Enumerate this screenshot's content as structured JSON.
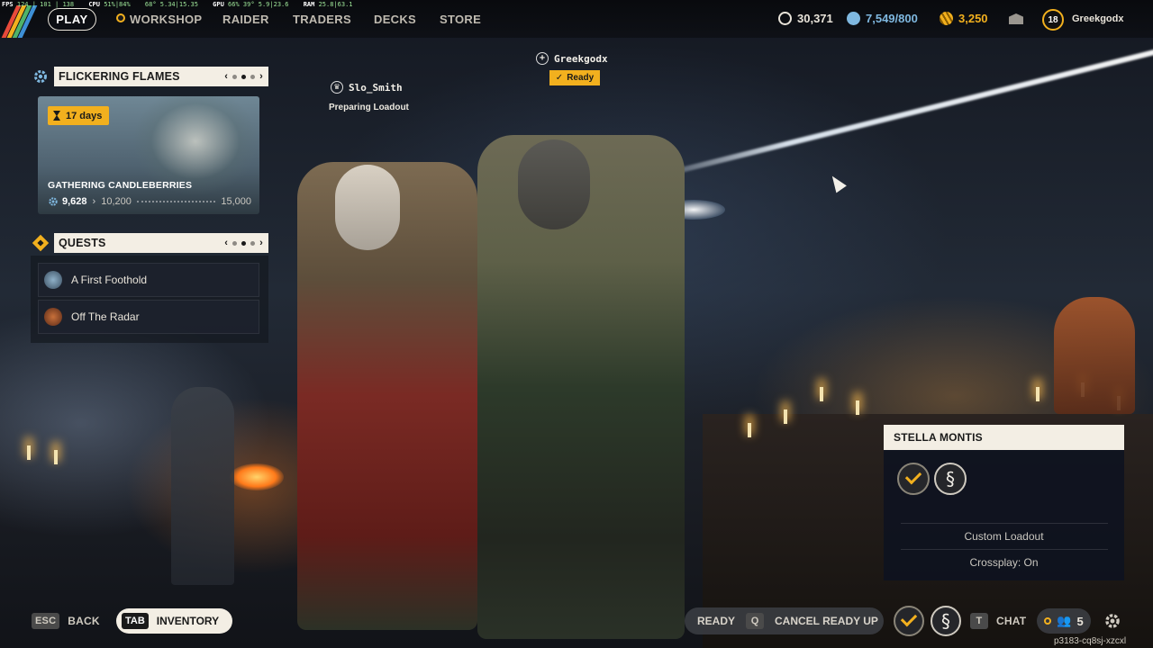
{
  "perf_overlay": {
    "fps_label": "FPS",
    "fps_value": "124 | 101 | 138",
    "cpu_label": "CPU",
    "cpu_value": "51%|84%",
    "gpu_label": "GPU",
    "gpu_value": "68°  5.34|15.35",
    "gpu2_label": "GPU",
    "gpu2_value": "66%  39°  5.9|23.6",
    "ram_label": "RAM",
    "ram_value": "25.8|63.1"
  },
  "topbar": {
    "play_label": "PLAY",
    "nav": [
      "WORKSHOP",
      "RAIDER",
      "TRADERS",
      "DECKS",
      "STORE"
    ],
    "currencies": [
      {
        "icon": "coin-icon",
        "value": "30,371",
        "color": "#e9e4da"
      },
      {
        "icon": "raider-token-icon",
        "value": "7,549/800",
        "color": "#7fb8e0"
      },
      {
        "icon": "premium-currency-icon",
        "value": "3,250",
        "color": "#f2b01e"
      }
    ],
    "level": "18",
    "username": "Greekgodx"
  },
  "event": {
    "title": "FLICKERING FLAMES",
    "days": "17 days",
    "name": "GATHERING CANDLEBERRIES",
    "current": "9,628",
    "next": "10,200",
    "max": "15,000",
    "page": 2,
    "pages": 3
  },
  "quests": {
    "title": "QUESTS",
    "items": [
      "A First Foothold",
      "Off The Radar"
    ],
    "page": 2,
    "pages": 3
  },
  "party": {
    "member1_name": "Slo_Smith",
    "member1_status": "Preparing Loadout",
    "member2_name": "Greekgodx",
    "member2_status": "Ready"
  },
  "member_card": {
    "name": "STELLA MONTIS",
    "loadout": "Custom Loadout",
    "crossplay": "Crossplay: On"
  },
  "bottombar": {
    "back_key": "ESC",
    "back_label": "BACK",
    "inventory_key": "TAB",
    "inventory_label": "INVENTORY",
    "ready_label": "READY",
    "cancel_key": "Q",
    "cancel_label": "CANCEL READY UP",
    "chat_key": "T",
    "chat_label": "CHAT",
    "party_count": "5",
    "session_id": "p3183-cq8sj-xzcxl"
  },
  "colors": {
    "accent": "#f2b01e",
    "panel_head": "#f3eee4"
  }
}
